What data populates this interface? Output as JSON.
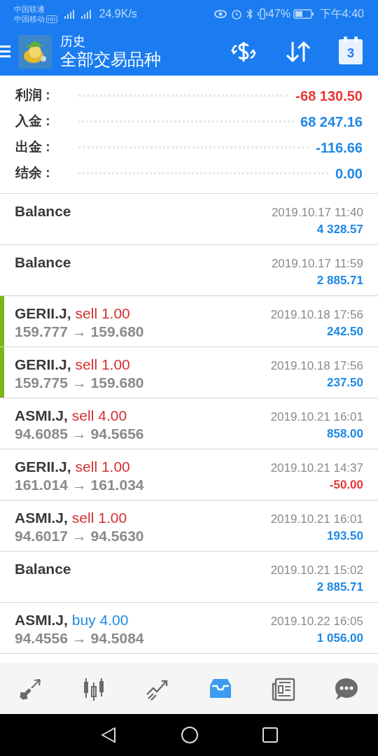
{
  "status_bar": {
    "carrier_1": "中国联通",
    "carrier_2": "中国移动",
    "hd_badge": "HD",
    "speed": "24.9K/s",
    "battery": "47%",
    "time": "下午4:40"
  },
  "header": {
    "title": "历史",
    "subtitle": "全部交易品种",
    "calendar_day": "3"
  },
  "summary": [
    {
      "label": "利润 :",
      "value": "-68 130.50",
      "color": "#e53935"
    },
    {
      "label": "入金 :",
      "value": "68 247.16",
      "color": "#1e88e5"
    },
    {
      "label": "出金 :",
      "value": "-116.66",
      "color": "#1e88e5"
    },
    {
      "label": "结余 :",
      "value": "0.00",
      "color": "#1e88e5"
    }
  ],
  "deals": [
    {
      "kind": "balance",
      "title": "Balance",
      "time": "2019.10.17 11:40",
      "amount": "4 328.57",
      "loss": false,
      "marked": false
    },
    {
      "kind": "balance",
      "title": "Balance",
      "time": "2019.10.17 11:59",
      "amount": "2 885.71",
      "loss": false,
      "marked": false
    },
    {
      "kind": "trade",
      "symbol": "GERII.J,",
      "side": "sell 1.00",
      "buy": false,
      "prices": "159.777 → 159.680",
      "time": "2019.10.18 17:56",
      "amount": "242.50",
      "loss": false,
      "marked": true
    },
    {
      "kind": "trade",
      "symbol": "GERII.J,",
      "side": "sell 1.00",
      "buy": false,
      "prices": "159.775 → 159.680",
      "time": "2019.10.18 17:56",
      "amount": "237.50",
      "loss": false,
      "marked": true
    },
    {
      "kind": "trade",
      "symbol": "ASMI.J,",
      "side": "sell 4.00",
      "buy": false,
      "prices": "94.6085 → 94.5656",
      "time": "2019.10.21 16:01",
      "amount": "858.00",
      "loss": false,
      "marked": false
    },
    {
      "kind": "trade",
      "symbol": "GERII.J,",
      "side": "sell 1.00",
      "buy": false,
      "prices": "161.014 → 161.034",
      "time": "2019.10.21 14:37",
      "amount": "-50.00",
      "loss": true,
      "marked": false
    },
    {
      "kind": "trade",
      "symbol": "ASMI.J,",
      "side": "sell 1.00",
      "buy": false,
      "prices": "94.6017 → 94.5630",
      "time": "2019.10.21 16:01",
      "amount": "193.50",
      "loss": false,
      "marked": false
    },
    {
      "kind": "balance",
      "title": "Balance",
      "time": "2019.10.21 15:02",
      "amount": "2 885.71",
      "loss": false,
      "marked": false
    },
    {
      "kind": "trade",
      "symbol": "ASMI.J,",
      "side": "buy 4.00",
      "buy": true,
      "prices": "94.4556 → 94.5084",
      "time": "2019.10.22 16:05",
      "amount": "1 056.00",
      "loss": false,
      "marked": false
    }
  ],
  "bottom_nav": [
    {
      "kind": "quotes",
      "selected": false
    },
    {
      "kind": "chart",
      "selected": false
    },
    {
      "kind": "trade",
      "selected": false
    },
    {
      "kind": "history",
      "selected": true
    },
    {
      "kind": "news",
      "selected": false
    },
    {
      "kind": "chat",
      "selected": false
    }
  ]
}
